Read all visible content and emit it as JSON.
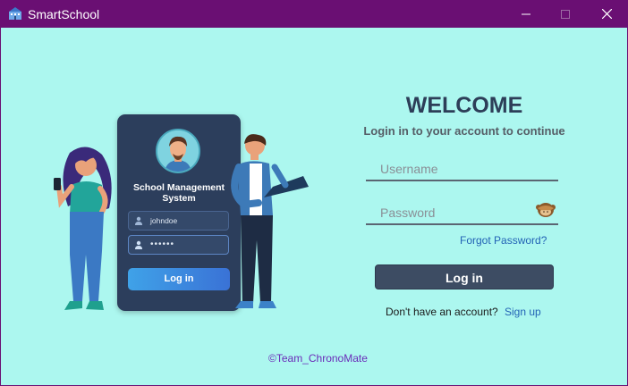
{
  "window": {
    "title": "SmartSchool",
    "controls": [
      "minimize",
      "maximize",
      "close"
    ]
  },
  "illustration": {
    "card_title": "School Management System",
    "username_value": "johndoe",
    "password_value": "••••••",
    "button_label": "Log in"
  },
  "login": {
    "heading": "WELCOME",
    "subtitle": "Login in to your account to continue",
    "username_placeholder": "Username",
    "password_placeholder": "Password",
    "forgot_label": "Forgot Password?",
    "button_label": "Log in",
    "signup_prompt": "Don't have an account?",
    "signup_label": "Sign up"
  },
  "footer": "©Team_ChronoMate",
  "colors": {
    "titlebar": "#6a0f73",
    "background": "#acf7ef",
    "button": "#3d4c63",
    "link": "#2363b5",
    "footer": "#6a2bb8"
  }
}
